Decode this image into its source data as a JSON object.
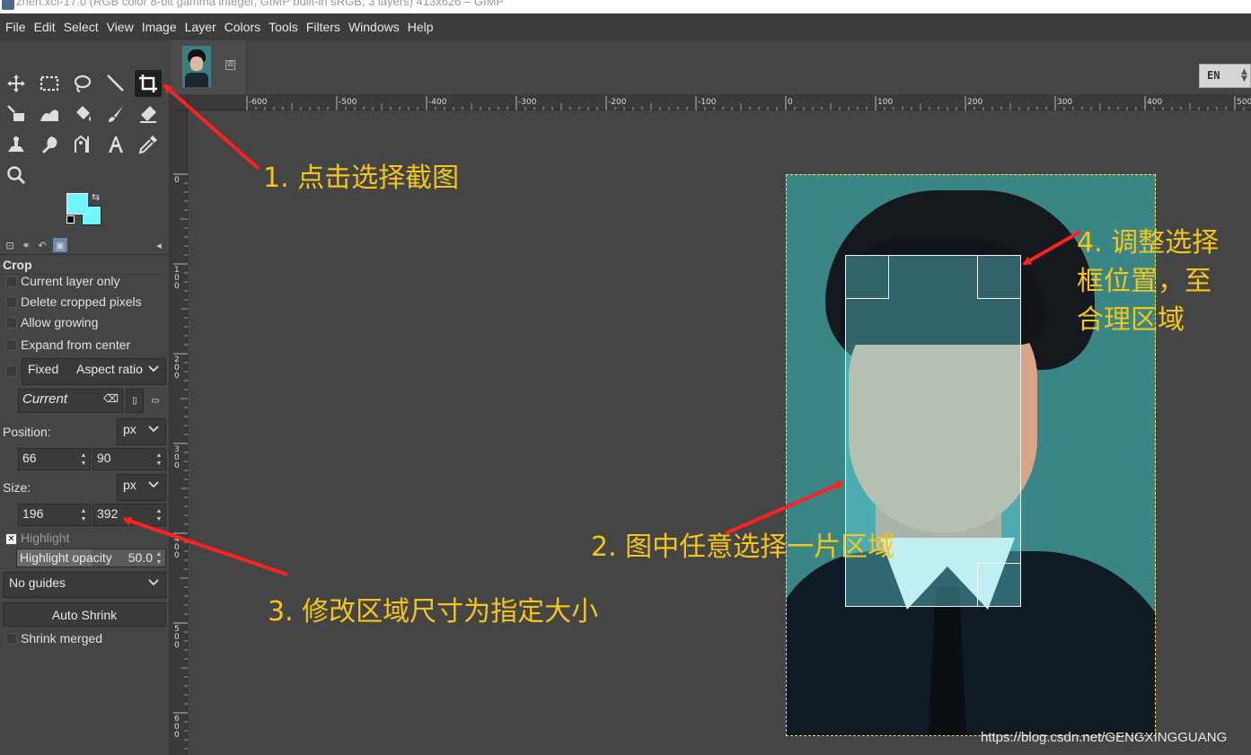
{
  "window": {
    "title": "zhen.xcf-17.0 (RGB color 8-bit gamma integer, GIMP built-in sRGB, 3 layers) 413x626 – GIMP"
  },
  "menu": [
    "File",
    "Edit",
    "Select",
    "View",
    "Image",
    "Layer",
    "Colors",
    "Tools",
    "Filters",
    "Windows",
    "Help"
  ],
  "colors": {
    "foreground": "#6ff6ff",
    "background": "#6ff6ff",
    "annotation": "#f5c518",
    "arrow": "#ff2222",
    "canvas_bg": "#454545",
    "layer_boundary": "#ffe34a"
  },
  "toolbox": {
    "tools": [
      {
        "icon": "move-tool-icon",
        "active": false
      },
      {
        "icon": "rect-select-tool-icon",
        "active": false
      },
      {
        "icon": "free-select-tool-icon",
        "active": false
      },
      {
        "icon": "fuzzy-select-tool-icon",
        "active": false
      },
      {
        "icon": "crop-tool-icon",
        "active": true
      },
      {
        "icon": "unified-transform-tool-icon",
        "active": false
      },
      {
        "icon": "warp-transform-tool-icon",
        "active": false
      },
      {
        "icon": "bucket-fill-tool-icon",
        "active": false
      },
      {
        "icon": "paintbrush-tool-icon",
        "active": false
      },
      {
        "icon": "eraser-tool-icon",
        "active": false
      },
      {
        "icon": "clone-tool-icon",
        "active": false
      },
      {
        "icon": "smudge-tool-icon",
        "active": false
      },
      {
        "icon": "paths-tool-icon",
        "active": false
      },
      {
        "icon": "text-tool-icon",
        "active": false
      },
      {
        "icon": "color-picker-tool-icon",
        "active": false
      },
      {
        "icon": "zoom-tool-icon",
        "active": false
      }
    ]
  },
  "tool_options": {
    "title": "Crop",
    "current_layer_only": "Current layer only",
    "delete_cropped_pixels": "Delete cropped pixels",
    "allow_growing": "Allow growing",
    "expand_from_center": "Expand from center",
    "fixed_label": "Fixed",
    "fixed_value": "Aspect ratio",
    "current_value": "Current",
    "position_label": "Position:",
    "position_unit": "px",
    "position_x": "66",
    "position_y": "90",
    "size_label": "Size:",
    "size_unit": "px",
    "size_w": "196",
    "size_h": "392",
    "highlight_label": "Highlight",
    "highlight_checked": true,
    "highlight_opacity_label": "Highlight opacity",
    "highlight_opacity_value": "50.0",
    "guides_value": "No guides",
    "auto_shrink_label": "Auto Shrink",
    "shrink_merged_label": "Shrink merged"
  },
  "image_tab": {
    "close_glyph": "⊠"
  },
  "input_method": {
    "code": "EN"
  },
  "ruler": {
    "horizontal_labels": [
      "-600",
      "-500",
      "-400",
      "-300",
      "-200",
      "-100",
      "0",
      "100",
      "200",
      "300",
      "400",
      "500"
    ],
    "vertical_labels": [
      "0",
      "100",
      "200",
      "300",
      "400",
      "500",
      "600"
    ]
  },
  "annotations": {
    "step1": "1. 点击选择截图",
    "step2": "2. 图中任意选择一片区域",
    "step3": "3. 修改区域尺寸为指定大小",
    "step4_line1": "4. 调整选择",
    "step4_line2": "框位置，至",
    "step4_line3": "合理区域"
  },
  "watermark": "https://blog.csdn.net/GENGXINGGUANG"
}
